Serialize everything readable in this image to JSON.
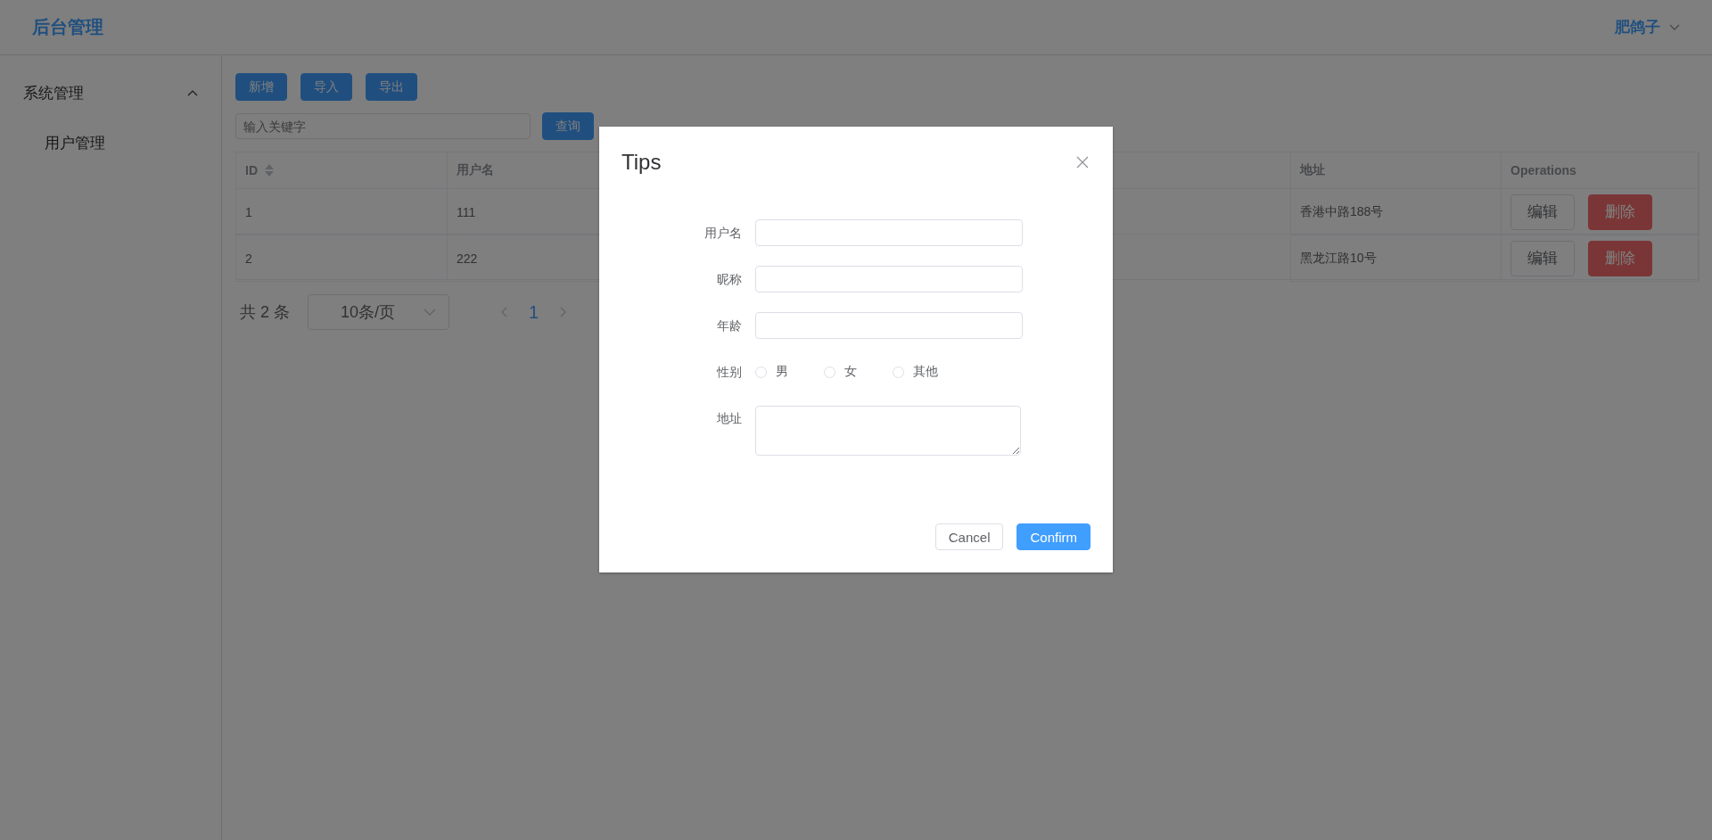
{
  "header": {
    "title": "后台管理",
    "user": "肥鸽子"
  },
  "sidebar": {
    "items": [
      {
        "label": "系统管理",
        "expanded": true,
        "children": [
          {
            "label": "用户管理",
            "selected": false
          }
        ]
      }
    ]
  },
  "toolbar": {
    "buttons": [
      "新增",
      "导入",
      "导出"
    ]
  },
  "search": {
    "placeholder": "输入关键字",
    "button": "查询"
  },
  "table": {
    "columns": [
      {
        "label": "ID",
        "sortable": true
      },
      {
        "label": "用户名",
        "sortable": false
      },
      {
        "label": "地址",
        "sortable": false
      },
      {
        "label": "Operations",
        "sortable": false
      }
    ],
    "rows": [
      {
        "cells": [
          "1",
          "111",
          "香港中路188号"
        ],
        "actions": [
          {
            "label": "编辑",
            "kind": "default"
          },
          {
            "label": "删除",
            "kind": "danger"
          }
        ]
      },
      {
        "cells": [
          "2",
          "222",
          "黑龙江路10号"
        ],
        "actions": [
          {
            "label": "编辑",
            "kind": "default"
          },
          {
            "label": "删除",
            "kind": "danger"
          }
        ]
      }
    ]
  },
  "pagination": {
    "total": "共 2 条",
    "page_size": "10条/页",
    "pages": [
      {
        "label": "1",
        "selected": true
      }
    ]
  },
  "dialog": {
    "title": "Tips",
    "fields": [
      {
        "kind": "input",
        "label": "用户名"
      },
      {
        "kind": "input",
        "label": "昵称"
      },
      {
        "kind": "input",
        "label": "年龄"
      },
      {
        "kind": "radio",
        "label": "性别",
        "options": [
          {
            "label": "男",
            "selected": false
          },
          {
            "label": "女",
            "selected": false
          },
          {
            "label": "其他",
            "selected": false
          }
        ]
      },
      {
        "kind": "textarea",
        "label": "地址"
      }
    ],
    "buttons": [
      {
        "label": "Cancel",
        "kind": "default"
      },
      {
        "label": "Confirm",
        "kind": "primary"
      }
    ]
  }
}
